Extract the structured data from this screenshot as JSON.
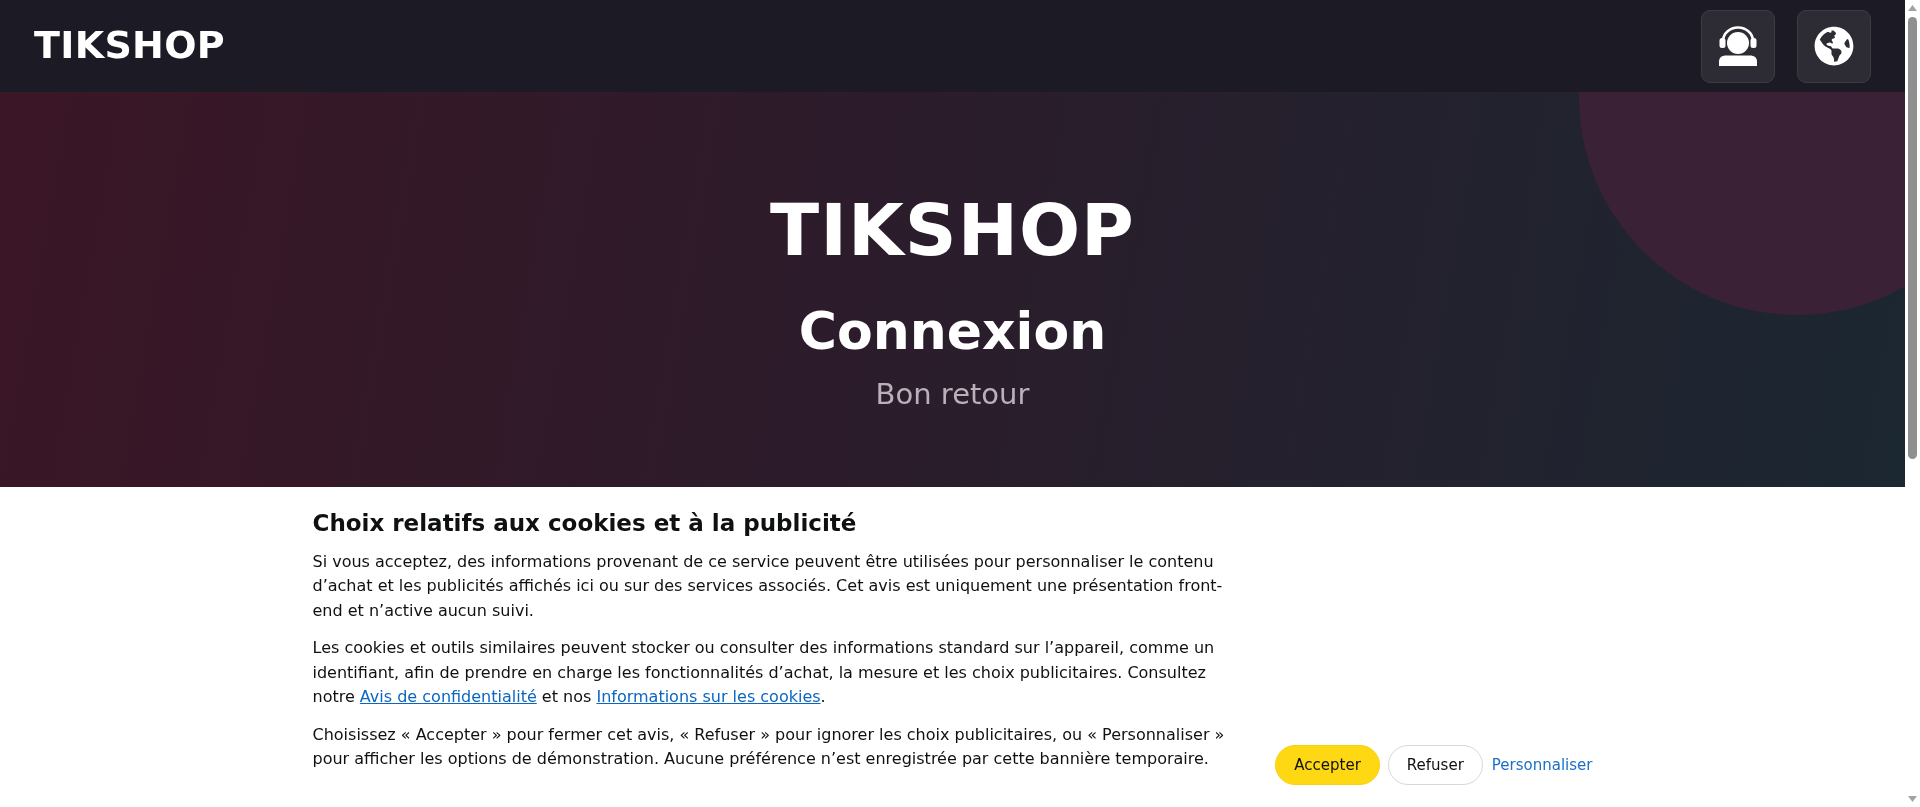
{
  "header": {
    "logo": "TIKSHOP",
    "buttons": [
      {
        "kind": "support"
      },
      {
        "kind": "language"
      }
    ]
  },
  "hero": {
    "brand": "TIKSHOP",
    "title": "Connexion",
    "subtitle": "Bon retour"
  },
  "cookie_banner": {
    "title": "Choix relatifs aux cookies et à la publicité",
    "paragraphs": [
      [
        {
          "kind": "text",
          "text": "Si vous acceptez, des informations provenant de ce service peuvent être utilisées pour personnaliser le contenu d’achat et les publicités affichés ici ou sur des services associés. Cet avis est uniquement une présentation front-end et n’active aucun suivi."
        }
      ],
      [
        {
          "kind": "text",
          "text": "Les cookies et outils similaires peuvent stocker ou consulter des informations standard sur l’appareil, comme un identifiant, afin de prendre en charge les fonctionnalités d’achat, la mesure et les choix publicitaires. Consultez notre "
        },
        {
          "kind": "link",
          "text": "Avis de confidentialité"
        },
        {
          "kind": "text",
          "text": " et nos "
        },
        {
          "kind": "link",
          "text": "Informations sur les cookies"
        },
        {
          "kind": "text",
          "text": "."
        }
      ],
      [
        {
          "kind": "text",
          "text": "Choisissez « Accepter » pour fermer cet avis, « Refuser » pour ignorer les choix publicitaires, ou « Personnaliser » pour afficher les options de démonstration. Aucune préférence n’est enregistrée par cette bannière temporaire."
        }
      ]
    ],
    "buttons": [
      {
        "kind": "primary",
        "label": "Accepter"
      },
      {
        "kind": "secondary",
        "label": "Refuser"
      },
      {
        "kind": "link",
        "label": "Personnaliser"
      }
    ]
  }
}
